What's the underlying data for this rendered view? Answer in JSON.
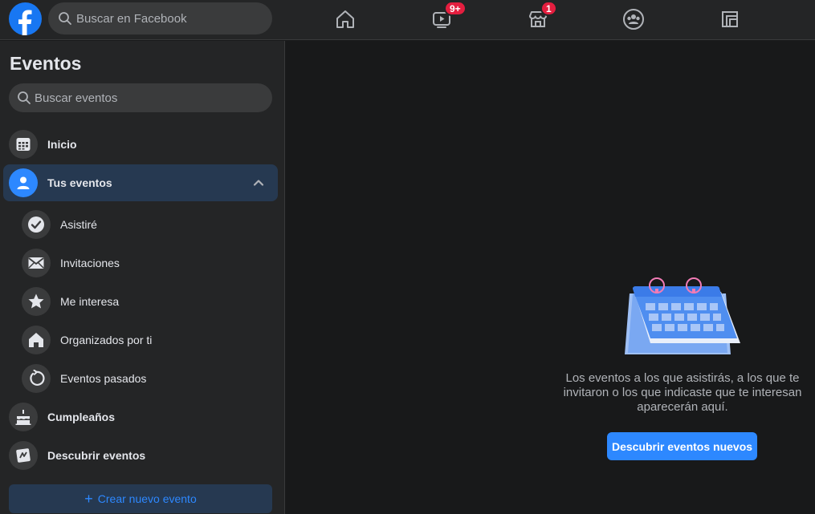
{
  "topbar": {
    "search_placeholder": "Buscar en Facebook",
    "nav": [
      {
        "icon": "home-icon"
      },
      {
        "icon": "watch-icon",
        "badge": "9+"
      },
      {
        "icon": "marketplace-icon",
        "badge": "1"
      },
      {
        "icon": "groups-icon"
      },
      {
        "icon": "gaming-icon"
      }
    ]
  },
  "sidebar": {
    "title": "Eventos",
    "search_placeholder": "Buscar eventos",
    "items": [
      {
        "label": "Inicio",
        "icon": "calendar-grid-icon"
      },
      {
        "label": "Tus eventos",
        "icon": "person-icon",
        "active": true
      },
      {
        "label": "Asistiré",
        "icon": "check-circle-icon"
      },
      {
        "label": "Invitaciones",
        "icon": "envelope-icon"
      },
      {
        "label": "Me interesa",
        "icon": "star-icon"
      },
      {
        "label": "Organizados por ti",
        "icon": "house-icon"
      },
      {
        "label": "Eventos pasados",
        "icon": "history-icon"
      },
      {
        "label": "Cumpleaños",
        "icon": "cake-icon"
      },
      {
        "label": "Descubrir eventos",
        "icon": "discover-icon"
      }
    ],
    "create_label": "Crear nuevo evento"
  },
  "main": {
    "empty_text": "Los eventos a los que asistirás, a los que te invitaron o los que indicaste que te interesan aparecerán aquí.",
    "discover_label": "Descubrir eventos nuevos"
  },
  "colors": {
    "accent": "#2d88ff",
    "background": "#18191a",
    "surface": "#242526",
    "badge": "#e41e3f"
  }
}
